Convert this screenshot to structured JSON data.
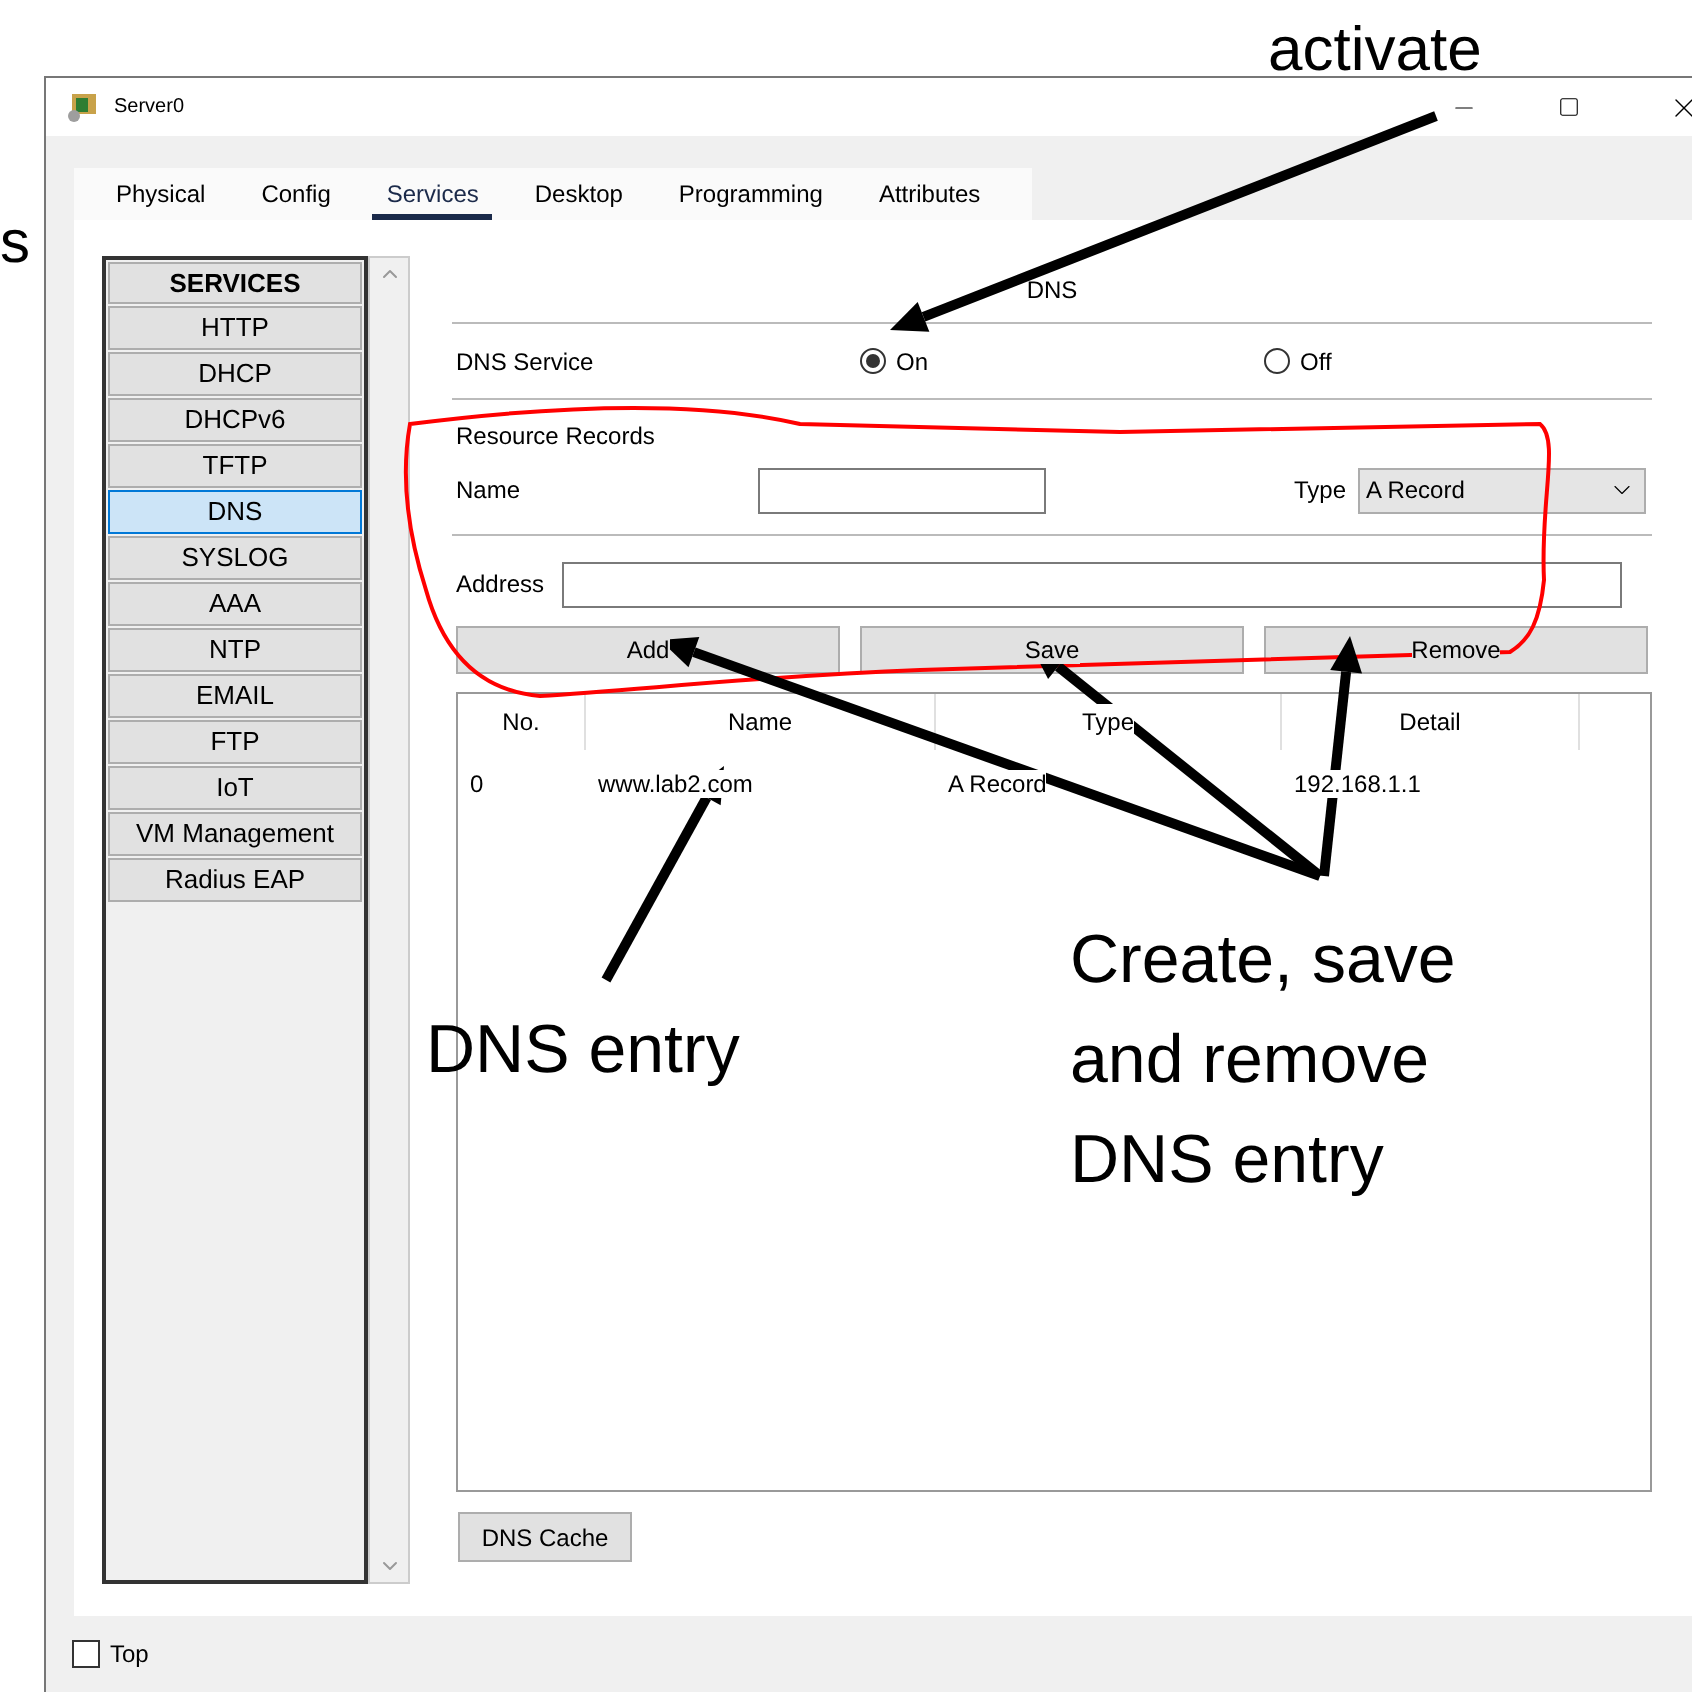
{
  "window": {
    "title": "Server0"
  },
  "tabs": [
    {
      "label": "Physical",
      "selected": false
    },
    {
      "label": "Config",
      "selected": false
    },
    {
      "label": "Services",
      "selected": true
    },
    {
      "label": "Desktop",
      "selected": false
    },
    {
      "label": "Programming",
      "selected": false
    },
    {
      "label": "Attributes",
      "selected": false
    }
  ],
  "services": {
    "heading": "SERVICES",
    "items": [
      {
        "label": "HTTP",
        "selected": false
      },
      {
        "label": "DHCP",
        "selected": false
      },
      {
        "label": "DHCPv6",
        "selected": false
      },
      {
        "label": "TFTP",
        "selected": false
      },
      {
        "label": "DNS",
        "selected": true
      },
      {
        "label": "SYSLOG",
        "selected": false
      },
      {
        "label": "AAA",
        "selected": false
      },
      {
        "label": "NTP",
        "selected": false
      },
      {
        "label": "EMAIL",
        "selected": false
      },
      {
        "label": "FTP",
        "selected": false
      },
      {
        "label": "IoT",
        "selected": false
      },
      {
        "label": "VM Management",
        "selected": false
      },
      {
        "label": "Radius EAP",
        "selected": false
      }
    ]
  },
  "dns": {
    "heading": "DNS",
    "service_label": "DNS Service",
    "service_options": [
      {
        "label": "On",
        "selected": true
      },
      {
        "label": "Off",
        "selected": false
      }
    ],
    "resource_records": "Resource Records",
    "name_label": "Name",
    "type_label": "Type",
    "type_value": "A Record",
    "address_label": "Address",
    "buttons": [
      "Add",
      "Save",
      "Remove"
    ],
    "table": {
      "columns": [
        "No.",
        "Name",
        "Type",
        "Detail"
      ],
      "rows": [
        [
          "0",
          "www.lab2.com",
          "A Record",
          "192.168.1.1"
        ]
      ]
    },
    "cache_button": "DNS Cache"
  },
  "top_checkbox": {
    "label": "Top",
    "checked": false
  },
  "annotations": [
    "s",
    "activate",
    "DNS entry",
    "Create, save and remove DNS entry"
  ]
}
